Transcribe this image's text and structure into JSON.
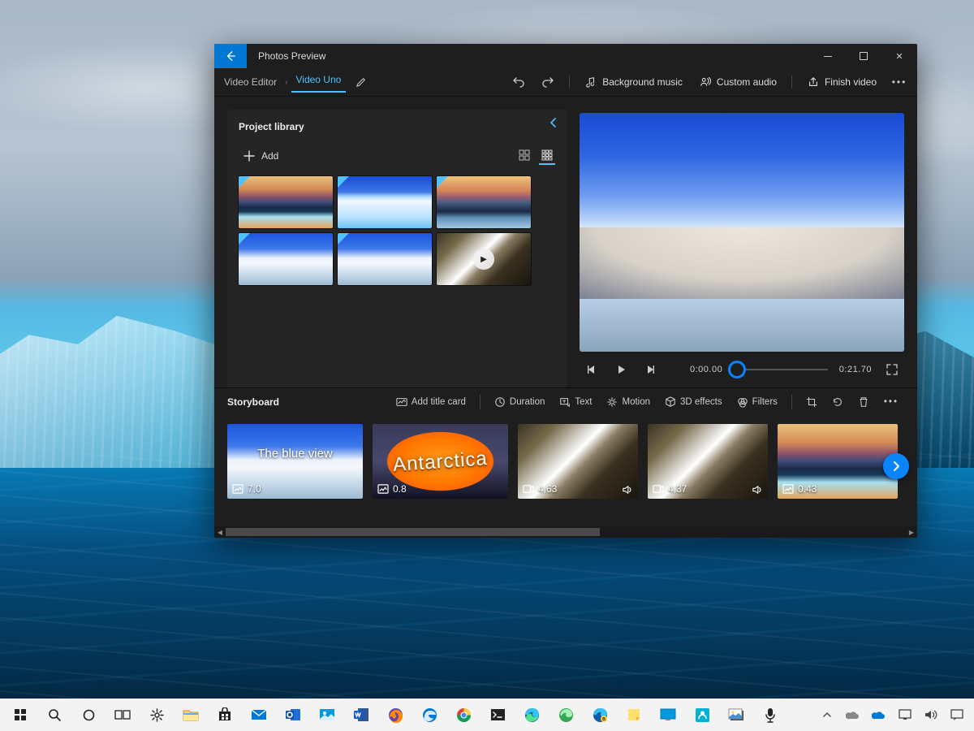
{
  "app": {
    "title": "Photos Preview"
  },
  "breadcrumb": {
    "root": "Video Editor",
    "project": "Video Uno"
  },
  "toolbar": {
    "background_music": "Background music",
    "custom_audio": "Custom audio",
    "finish_video": "Finish video"
  },
  "library": {
    "title": "Project library",
    "add": "Add",
    "items": [
      {
        "art": "art-sunset",
        "dog": true
      },
      {
        "art": "art-ice",
        "dog": true
      },
      {
        "art": "art-dusk",
        "dog": true
      },
      {
        "art": "art-snow",
        "dog": true
      },
      {
        "art": "art-snow",
        "dog": true
      },
      {
        "art": "art-creek",
        "dog": false,
        "video": true
      }
    ]
  },
  "player": {
    "current_time": "0:00.00",
    "total_time": "0:21.70",
    "progress_pct": 3
  },
  "storyboard": {
    "title": "Storyboard",
    "buttons": {
      "add_title_card": "Add title card",
      "duration": "Duration",
      "text": "Text",
      "motion": "Motion",
      "effects3d": "3D effects",
      "filters": "Filters"
    },
    "clips": [
      {
        "art": "art-snow",
        "kind": "image",
        "duration": "7.0",
        "title": "The blue view",
        "selected": true,
        "sel_pct": 58
      },
      {
        "art": "art-orange",
        "kind": "image",
        "duration": "0.8",
        "overlay_text": "Antarctica"
      },
      {
        "art": "art-creek",
        "kind": "video",
        "duration": "4.63",
        "sound": true
      },
      {
        "art": "art-creek",
        "kind": "video",
        "duration": "4.37",
        "sound": true
      },
      {
        "art": "art-sunset",
        "kind": "image",
        "duration": "0.43"
      }
    ],
    "scroll": {
      "thumb_left_pct": 0,
      "thumb_width_pct": 55
    }
  },
  "taskbar": {
    "time": "",
    "icons": [
      "start",
      "search",
      "cortana",
      "taskview",
      "settings",
      "explorer",
      "store",
      "mail",
      "outlook",
      "photos",
      "word",
      "firefox",
      "edge-legacy",
      "chrome",
      "terminal",
      "edge",
      "edge-dev",
      "edge-beta",
      "notes",
      "desktop",
      "paint3d",
      "gallery",
      "mic"
    ],
    "tray": [
      "up",
      "cloud-grey",
      "cloud-blue",
      "connect",
      "speaker",
      "notifications"
    ]
  },
  "colors": {
    "accent": "#0a84ff",
    "titlebar_back": "#0078d4"
  }
}
